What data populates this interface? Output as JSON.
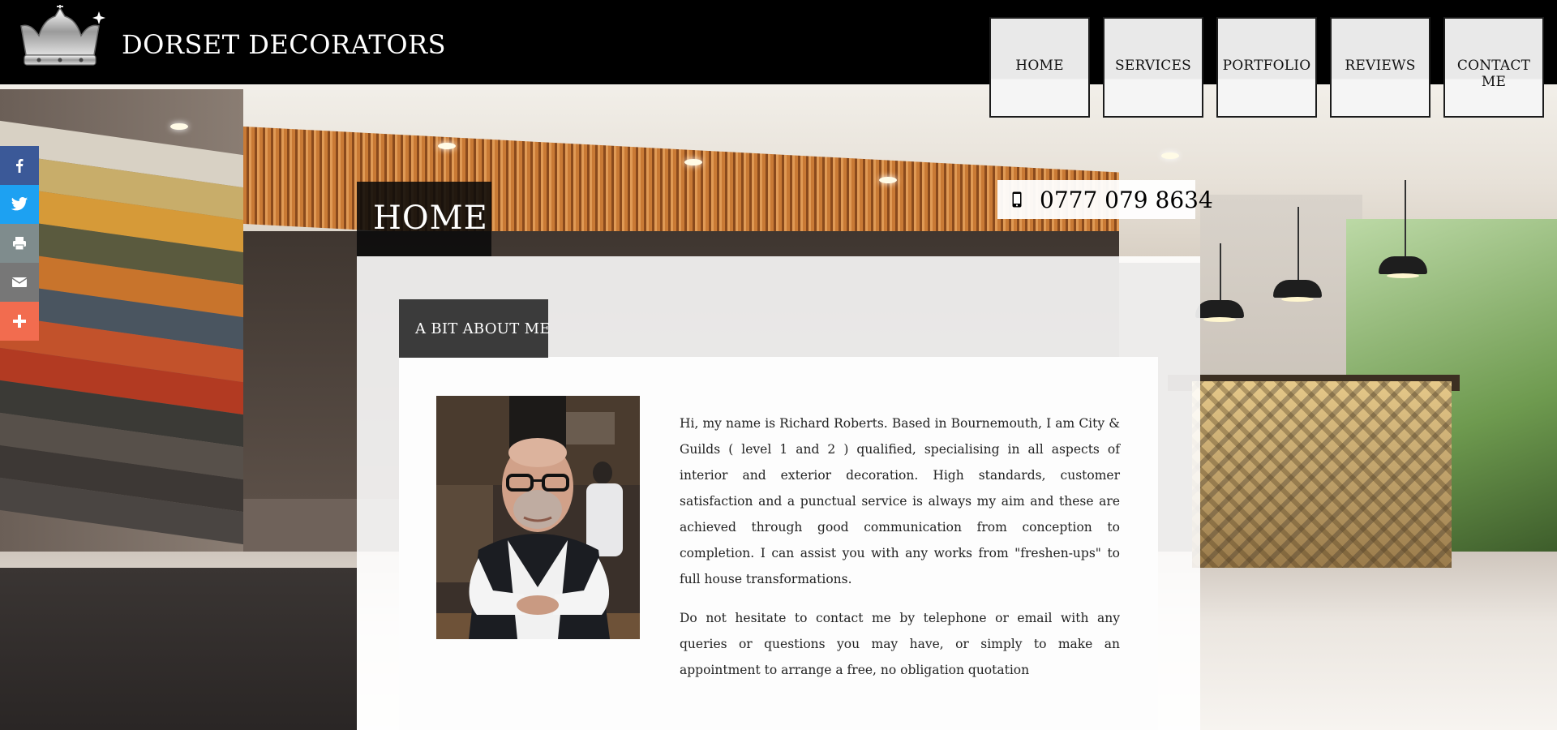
{
  "header": {
    "brand": "DORSET DECORATORS",
    "logo_icon": "crown-icon"
  },
  "nav": {
    "items": [
      {
        "label": "HOME"
      },
      {
        "label": "SERVICES"
      },
      {
        "label": "PORTFOLIO"
      },
      {
        "label": "REVIEWS"
      },
      {
        "label": "CONTACT ME"
      }
    ]
  },
  "share": {
    "buttons": [
      {
        "icon": "facebook-icon",
        "color": "#3b5998"
      },
      {
        "icon": "twitter-icon",
        "color": "#1da1f2"
      },
      {
        "icon": "print-icon",
        "color": "#7f8c8d"
      },
      {
        "icon": "email-icon",
        "color": "#777777"
      },
      {
        "icon": "more-plus-icon",
        "color": "#f26c4f"
      }
    ]
  },
  "page": {
    "title": "HOME",
    "phone_icon": "mobile-phone-icon",
    "phone": "0777 079 8634"
  },
  "about": {
    "section_title": "A BIT ABOUT ME",
    "photo_alt": "Portrait of Richard Roberts",
    "paragraph1": "Hi, my name is Richard Roberts. Based in Bournemouth, I am City & Guilds ( level 1 and 2 ) qualified, specialising in all aspects of interior and exterior decoration. High standards, customer satisfaction and a punctual service is always my aim and these are achieved through good communication from conception to completion. I can assist you with any works from \"freshen-ups\" to full house transformations.",
    "paragraph2": "Do not hesitate to contact me by telephone or email with any queries or questions you may have, or simply to make an appointment to arrange a free, no obligation quotation"
  }
}
